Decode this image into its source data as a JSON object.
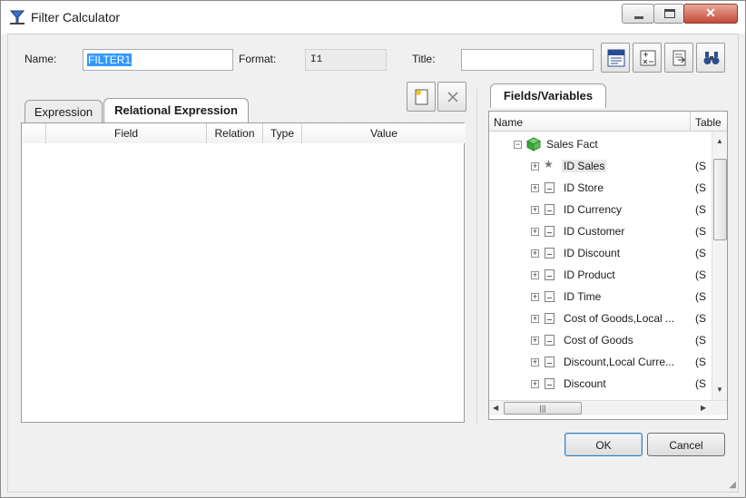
{
  "window": {
    "title": "Filter Calculator",
    "min_glyph": "",
    "max_glyph": "",
    "close_glyph": "✕"
  },
  "form": {
    "name_label": "Name:",
    "name_value": "FILTER1",
    "format_label": "Format:",
    "format_value": "I1",
    "title_label": "Title:",
    "title_value": ""
  },
  "toolbar_icons": [
    "sql-icon",
    "calculator-icon",
    "edit-icon",
    "binoculars-icon"
  ],
  "expression_tabs": [
    {
      "label": "Expression",
      "active": false
    },
    {
      "label": "Relational Expression",
      "active": true
    }
  ],
  "grid_columns": [
    "",
    "Field",
    "Relation",
    "Type",
    "Value"
  ],
  "fields_tab": "Fields/Variables",
  "tree": {
    "col_name": "Name",
    "col_table": "Table",
    "root": {
      "label": "Sales Fact",
      "expander": "−"
    },
    "items": [
      {
        "label": "ID Sales",
        "table": "(S",
        "icon": "star-icon",
        "highlight": true
      },
      {
        "label": "ID Store",
        "table": "(S",
        "icon": "field-icon"
      },
      {
        "label": "ID Currency",
        "table": "(S",
        "icon": "field-icon"
      },
      {
        "label": "ID Customer",
        "table": "(S",
        "icon": "field-icon"
      },
      {
        "label": "ID Discount",
        "table": "(S",
        "icon": "field-icon"
      },
      {
        "label": "ID Product",
        "table": "(S",
        "icon": "field-icon"
      },
      {
        "label": "ID Time",
        "table": "(S",
        "icon": "field-icon"
      },
      {
        "label": "Cost of Goods,Local ...",
        "table": "(S",
        "icon": "field-icon"
      },
      {
        "label": "Cost of Goods",
        "table": "(S",
        "icon": "field-icon"
      },
      {
        "label": "Discount,Local Curre...",
        "table": "(S",
        "icon": "field-icon"
      },
      {
        "label": "Discount",
        "table": "(S",
        "icon": "field-icon"
      }
    ]
  },
  "buttons": {
    "ok": "OK",
    "cancel": "Cancel"
  },
  "colors": {
    "selection": "#3399ff",
    "cube": "#3aa63a"
  }
}
